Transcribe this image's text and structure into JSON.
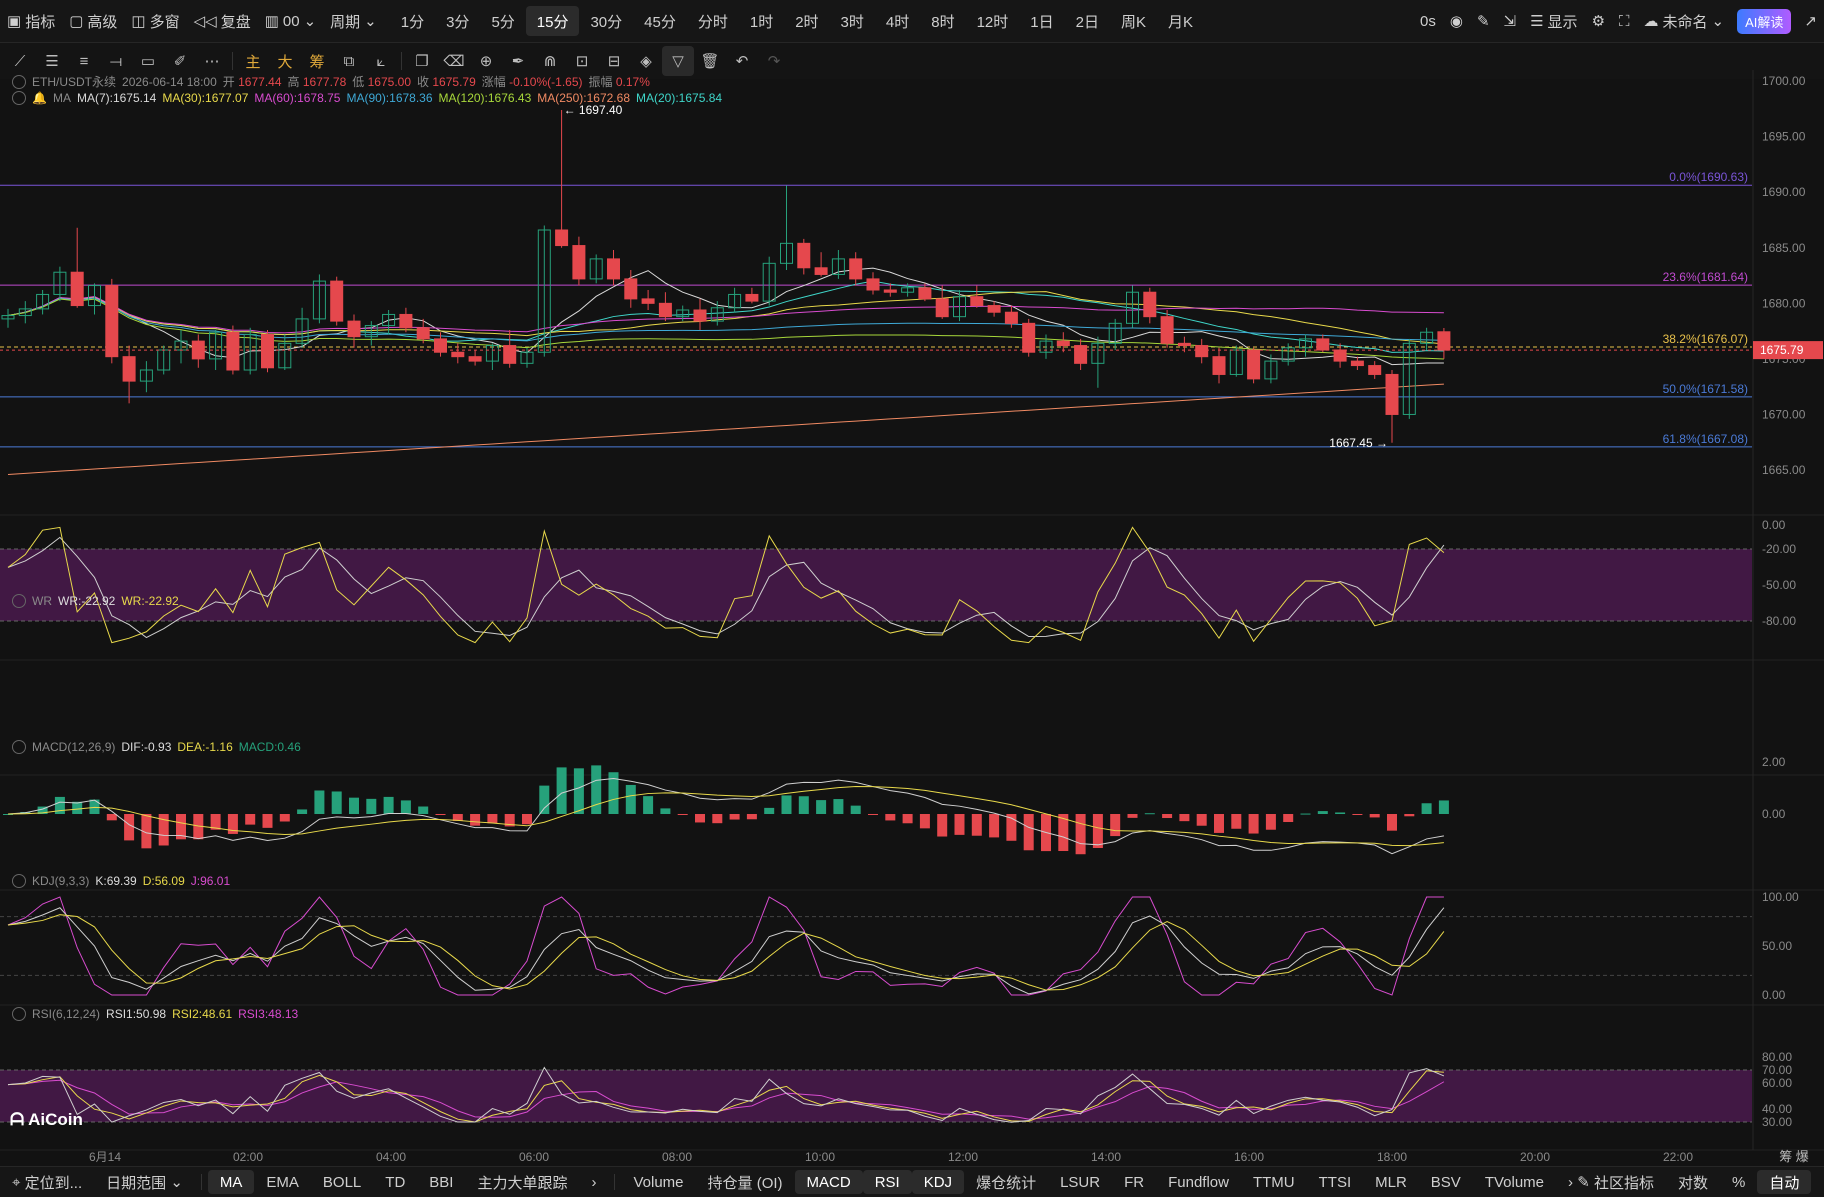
{
  "topbar": {
    "left": [
      {
        "icon": "indicator-icon",
        "label": "指标"
      },
      {
        "icon": "advanced-icon",
        "label": "高级"
      },
      {
        "icon": "multi-window-icon",
        "label": "多窗"
      },
      {
        "icon": "replay-icon",
        "label": "复盘"
      },
      {
        "icon": "layout-icon",
        "label": "00"
      },
      {
        "icon": "",
        "label": "周期"
      }
    ],
    "periods": [
      "1分",
      "3分",
      "5分",
      "15分",
      "30分",
      "45分",
      "分时",
      "1时",
      "2时",
      "3时",
      "4时",
      "8时",
      "12时",
      "1日",
      "2日",
      "周K",
      "月K"
    ],
    "active_period": "15分",
    "right": {
      "latency": "0s",
      "display": "显示",
      "unnamed": "未命名",
      "ai": "AI解读"
    }
  },
  "colors": {
    "up": "#26a17b",
    "down": "#e5484d",
    "ma7": "#d9d9d9",
    "ma30": "#e8d94b",
    "ma60": "#d84ccf",
    "ma90": "#3fa9d6",
    "ma120": "#a8d83b",
    "ma250": "#f08a63",
    "ma20": "#3fd6c9",
    "fib": "#7b55d8",
    "wrfill": "#4a1a4e"
  },
  "main_legend": {
    "symbol": "ETH/USDT永续",
    "time": "2026-06-14 18:00",
    "open_label": "开",
    "open": "1677.44",
    "high_label": "高",
    "high": "1677.78",
    "low_label": "低",
    "low": "1675.00",
    "close_label": "收",
    "close": "1675.79",
    "chg_label": "涨幅",
    "chg": "-0.10%(-1.65)",
    "amp_label": "振幅",
    "amp": "0.17%",
    "ma_name": "MA",
    "ma": [
      {
        "k": "MA(7)",
        "v": "1675.14",
        "c": "#d9d9d9"
      },
      {
        "k": "MA(30)",
        "v": "1677.07",
        "c": "#e8d94b"
      },
      {
        "k": "MA(60)",
        "v": "1678.75",
        "c": "#d84ccf"
      },
      {
        "k": "MA(90)",
        "v": "1678.36",
        "c": "#3fa9d6"
      },
      {
        "k": "MA(120)",
        "v": "1676.43",
        "c": "#a8d83b"
      },
      {
        "k": "MA(250)",
        "v": "1672.68",
        "c": "#f08a63"
      },
      {
        "k": "MA(20)",
        "v": "1675.84",
        "c": "#3fd6c9"
      }
    ]
  },
  "price_axis": [
    "1700.00",
    "1695.00",
    "1690.00",
    "1685.00",
    "1680.00",
    "1675.00",
    "1670.00",
    "1665.00"
  ],
  "price_range": [
    1662.3,
    1701.0
  ],
  "current_price": "1675.79",
  "high_marker": "1697.40",
  "low_marker": "1667.45",
  "fib": [
    {
      "label": "0.0%(1690.63)",
      "price": 1690.63,
      "color": "#7b55d8"
    },
    {
      "label": "23.6%(1681.64)",
      "price": 1681.64,
      "color": "#c04bd0"
    },
    {
      "label": "38.2%(1676.07)",
      "price": 1676.07,
      "color": "#e8c14b"
    },
    {
      "label": "50.0%(1671.58)",
      "price": 1671.58,
      "color": "#4b7bd8"
    },
    {
      "label": "61.8%(1667.08)",
      "price": 1667.08,
      "color": "#4b7bd8"
    }
  ],
  "time_axis": [
    "6月14",
    "02:00",
    "04:00",
    "06:00",
    "08:00",
    "10:00",
    "12:00",
    "14:00",
    "16:00",
    "18:00",
    "20:00",
    "22:00"
  ],
  "time_axis_extra": "筹 爆",
  "wr": {
    "name": "WR",
    "v1_label": "WR:-22.92",
    "v2_label": "WR:-22.92",
    "axis": [
      "0.00",
      "-20.00",
      "-50.00",
      "-80.00"
    ]
  },
  "macd": {
    "name": "MACD(12,26,9)",
    "dif": "DIF:-0.93",
    "dea": "DEA:-1.16",
    "macd": "MACD:0.46",
    "axis": [
      "2.00",
      "0.00"
    ]
  },
  "kdj": {
    "name": "KDJ(9,3,3)",
    "k": "K:69.39",
    "d": "D:56.09",
    "j": "J:96.01",
    "axis": [
      "100.00",
      "50.00",
      "0.00"
    ]
  },
  "rsi": {
    "name": "RSI(6,12,24)",
    "r1": "RSI1:50.98",
    "r2": "RSI2:48.61",
    "r3": "RSI3:48.13",
    "axis": [
      "80.00",
      "70.00",
      "60.00",
      "40.00",
      "30.00"
    ]
  },
  "logo": "AiCoin",
  "bottombar": {
    "left": [
      "定位到...",
      "日期范围"
    ],
    "main_inds": [
      "MA",
      "EMA",
      "BOLL",
      "TD",
      "BBI",
      "主力大单跟踪"
    ],
    "main_active": "MA",
    "sub_inds": [
      "Volume",
      "持仓量 (OI)",
      "MACD",
      "RSI",
      "KDJ",
      "爆仓统计",
      "LSUR",
      "FR",
      "Fundflow",
      "TTMU",
      "TTSI",
      "MLR",
      "BSV",
      "TVolume"
    ],
    "sub_active": [
      "MACD",
      "RSI",
      "KDJ"
    ],
    "right": [
      "社区指标",
      "对数",
      "%",
      "自动"
    ]
  },
  "chart_data": {
    "type": "candlestick",
    "title": "ETH/USDT永续 15分",
    "x_labels": [
      "6月14",
      "02:00",
      "04:00",
      "06:00",
      "08:00",
      "10:00",
      "12:00",
      "14:00",
      "16:00",
      "18:00"
    ],
    "candles": [
      [
        1678.6,
        1679.5,
        1677.8,
        1678.9
      ],
      [
        1678.9,
        1680.2,
        1678.2,
        1679.5
      ],
      [
        1679.5,
        1681.2,
        1679.0,
        1680.8
      ],
      [
        1680.8,
        1683.3,
        1680.2,
        1682.8
      ],
      [
        1682.8,
        1686.8,
        1679.6,
        1679.8
      ],
      [
        1679.8,
        1681.8,
        1679.0,
        1681.6
      ],
      [
        1681.6,
        1682.2,
        1674.6,
        1675.2
      ],
      [
        1675.2,
        1676.2,
        1671.0,
        1673.0
      ],
      [
        1673.0,
        1674.8,
        1672.0,
        1674.0
      ],
      [
        1674.0,
        1676.2,
        1673.6,
        1675.8
      ],
      [
        1675.8,
        1677.6,
        1674.6,
        1676.6
      ],
      [
        1676.6,
        1677.2,
        1674.2,
        1675.0
      ],
      [
        1675.0,
        1677.6,
        1674.0,
        1677.4
      ],
      [
        1677.4,
        1678.0,
        1673.6,
        1674.0
      ],
      [
        1674.0,
        1677.8,
        1673.6,
        1677.2
      ],
      [
        1677.2,
        1677.6,
        1673.8,
        1674.2
      ],
      [
        1674.2,
        1677.2,
        1674.0,
        1676.4
      ],
      [
        1676.4,
        1679.6,
        1676.0,
        1678.6
      ],
      [
        1678.6,
        1682.6,
        1678.2,
        1682.0
      ],
      [
        1682.0,
        1682.4,
        1678.0,
        1678.4
      ],
      [
        1678.4,
        1679.0,
        1676.0,
        1677.0
      ],
      [
        1677.0,
        1678.4,
        1676.2,
        1678.0
      ],
      [
        1678.0,
        1679.4,
        1677.2,
        1679.0
      ],
      [
        1679.0,
        1679.6,
        1677.4,
        1677.8
      ],
      [
        1677.8,
        1678.6,
        1676.4,
        1676.8
      ],
      [
        1676.8,
        1677.4,
        1675.2,
        1675.6
      ],
      [
        1675.6,
        1676.4,
        1674.6,
        1675.2
      ],
      [
        1675.2,
        1675.8,
        1674.4,
        1674.8
      ],
      [
        1674.8,
        1676.4,
        1674.0,
        1676.2
      ],
      [
        1676.2,
        1677.6,
        1674.2,
        1674.6
      ],
      [
        1674.6,
        1676.0,
        1674.2,
        1675.6
      ],
      [
        1675.6,
        1687.0,
        1675.2,
        1686.6
      ],
      [
        1686.6,
        1697.4,
        1685.0,
        1685.2
      ],
      [
        1685.2,
        1686.0,
        1681.6,
        1682.2
      ],
      [
        1682.2,
        1684.4,
        1681.8,
        1684.0
      ],
      [
        1684.0,
        1684.8,
        1681.6,
        1682.2
      ],
      [
        1682.2,
        1683.0,
        1679.6,
        1680.4
      ],
      [
        1680.4,
        1681.2,
        1679.4,
        1680.0
      ],
      [
        1680.0,
        1681.0,
        1678.4,
        1678.8
      ],
      [
        1678.8,
        1679.8,
        1678.4,
        1679.4
      ],
      [
        1679.4,
        1680.4,
        1677.6,
        1678.4
      ],
      [
        1678.4,
        1680.2,
        1678.0,
        1679.6
      ],
      [
        1679.6,
        1681.4,
        1679.2,
        1680.8
      ],
      [
        1680.8,
        1681.4,
        1680.0,
        1680.2
      ],
      [
        1680.2,
        1684.2,
        1679.8,
        1683.6
      ],
      [
        1683.6,
        1690.6,
        1683.0,
        1685.4
      ],
      [
        1685.4,
        1685.8,
        1682.6,
        1683.2
      ],
      [
        1683.2,
        1684.6,
        1682.4,
        1682.6
      ],
      [
        1682.6,
        1684.8,
        1682.2,
        1684.0
      ],
      [
        1684.0,
        1684.6,
        1681.6,
        1682.2
      ],
      [
        1682.2,
        1682.8,
        1680.8,
        1681.2
      ],
      [
        1681.2,
        1681.8,
        1680.6,
        1681.0
      ],
      [
        1681.0,
        1681.8,
        1680.6,
        1681.4
      ],
      [
        1681.4,
        1681.8,
        1680.2,
        1680.4
      ],
      [
        1680.4,
        1681.6,
        1678.6,
        1678.8
      ],
      [
        1678.8,
        1681.2,
        1678.4,
        1680.6
      ],
      [
        1680.6,
        1681.6,
        1679.6,
        1679.8
      ],
      [
        1679.8,
        1680.2,
        1678.8,
        1679.2
      ],
      [
        1679.2,
        1679.8,
        1677.8,
        1678.2
      ],
      [
        1678.2,
        1678.6,
        1675.2,
        1675.6
      ],
      [
        1675.6,
        1677.2,
        1675.0,
        1676.6
      ],
      [
        1676.6,
        1677.4,
        1675.6,
        1676.2
      ],
      [
        1676.2,
        1676.8,
        1674.0,
        1674.6
      ],
      [
        1674.6,
        1677.0,
        1672.4,
        1676.4
      ],
      [
        1676.4,
        1678.6,
        1675.8,
        1678.2
      ],
      [
        1678.2,
        1681.6,
        1677.8,
        1681.0
      ],
      [
        1681.0,
        1681.4,
        1678.2,
        1678.8
      ],
      [
        1678.8,
        1679.4,
        1676.0,
        1676.4
      ],
      [
        1676.4,
        1677.0,
        1675.6,
        1676.2
      ],
      [
        1676.2,
        1676.8,
        1674.6,
        1675.2
      ],
      [
        1675.2,
        1676.0,
        1672.8,
        1673.6
      ],
      [
        1673.6,
        1676.2,
        1673.4,
        1675.8
      ],
      [
        1675.8,
        1676.0,
        1672.8,
        1673.2
      ],
      [
        1673.2,
        1675.4,
        1672.8,
        1674.8
      ],
      [
        1674.8,
        1676.4,
        1674.4,
        1676.0
      ],
      [
        1676.0,
        1677.2,
        1675.2,
        1676.8
      ],
      [
        1676.8,
        1677.2,
        1675.6,
        1675.8
      ],
      [
        1675.8,
        1676.4,
        1674.2,
        1674.8
      ],
      [
        1674.8,
        1675.2,
        1674.0,
        1674.4
      ],
      [
        1674.4,
        1674.8,
        1673.2,
        1673.6
      ],
      [
        1673.6,
        1674.0,
        1667.45,
        1670.0
      ],
      [
        1670.0,
        1676.8,
        1669.6,
        1676.4
      ],
      [
        1676.4,
        1677.8,
        1675.8,
        1677.4
      ],
      [
        1677.44,
        1677.78,
        1675.0,
        1675.79
      ]
    ]
  }
}
